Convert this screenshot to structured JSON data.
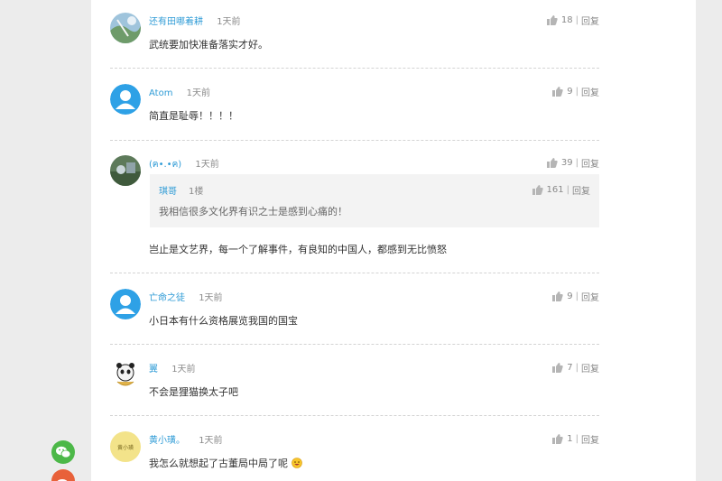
{
  "colors": {
    "username": "#2e9bd6",
    "meta": "#8a8a8a",
    "wechat": "#4cb848",
    "weibo": "#e8613a",
    "default_avatar": "#2ea1e6"
  },
  "comments": [
    {
      "user": "还有田哪着耕",
      "time": "1天前",
      "likes": "18",
      "reply": "回复",
      "text": "武统要加快准备落实才好。",
      "avatar": "photo-avatar-sky"
    },
    {
      "user": "Atom",
      "time": "1天前",
      "likes": "9",
      "reply": "回复",
      "text": "简直是耻辱！！！！",
      "avatar": "default-user-avatar"
    },
    {
      "user": "(ฅ•.•ฅ)",
      "time": "1天前",
      "likes": "39",
      "reply": "回复",
      "text": "岂止是文艺界，每一个了解事件，有良知的中国人，都感到无比愤怒",
      "avatar": "photo-avatar-scene",
      "quote": {
        "user": "琪哥",
        "floor": "1楼",
        "likes": "161",
        "reply": "回复",
        "text": "我相信很多文化界有识之士是感到心痛的！"
      }
    },
    {
      "user": "亡命之徒",
      "time": "1天前",
      "likes": "9",
      "reply": "回复",
      "text": "小日本有什么资格展览我国的国宝",
      "avatar": "default-user-avatar"
    },
    {
      "user": "翼",
      "time": "1天前",
      "likes": "7",
      "reply": "回复",
      "text": "不会是狸猫换太子吧",
      "avatar": "panda-avatar"
    },
    {
      "user": "黄小璜。",
      "time": "1天前",
      "likes": "1",
      "reply": "回复",
      "text": "我怎么就想起了古董局中局了呢",
      "avatar_text": "黄小璜",
      "emoji": "grinning-emoji"
    }
  ],
  "share": [
    {
      "icon": "wechat-icon"
    },
    {
      "icon": "weibo-icon"
    }
  ]
}
